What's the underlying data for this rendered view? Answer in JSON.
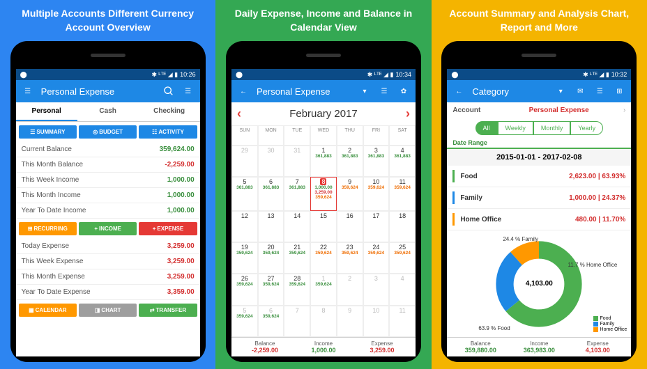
{
  "panels": {
    "p1": {
      "title": "Multiple Accounts Different Currency\nAccount Overview"
    },
    "p2": {
      "title": "Daily Expense, Income and Balance\nin Calendar View"
    },
    "p3": {
      "title": "Account Summary and Analysis\nChart, Report and More"
    }
  },
  "status": {
    "time1": "10:26",
    "time2": "10:34",
    "time3": "10:32"
  },
  "app1": {
    "title": "Personal Expense",
    "tabs": [
      "Personal",
      "Cash",
      "Checking"
    ],
    "btns1": [
      "SUMMARY",
      "BUDGET",
      "ACTIVITY"
    ],
    "rows1": [
      {
        "l": "Current Balance",
        "v": "359,624.00",
        "c": "green"
      },
      {
        "l": "This Month Balance",
        "v": "-2,259.00",
        "c": "red"
      },
      {
        "l": "This Week Income",
        "v": "1,000.00",
        "c": "green"
      },
      {
        "l": "This Month Income",
        "v": "1,000.00",
        "c": "green"
      },
      {
        "l": "Year To Date Income",
        "v": "1,000.00",
        "c": "green"
      }
    ],
    "btns2": [
      "RECURRING",
      "INCOME",
      "EXPENSE"
    ],
    "rows2": [
      {
        "l": "Today Expense",
        "v": "3,259.00",
        "c": "red"
      },
      {
        "l": "This Week Expense",
        "v": "3,259.00",
        "c": "red"
      },
      {
        "l": "This Month Expense",
        "v": "3,259.00",
        "c": "red"
      },
      {
        "l": "Year To Date Expense",
        "v": "3,359.00",
        "c": "red"
      }
    ],
    "btns3": [
      "CALENDAR",
      "CHART",
      "TRANSFER"
    ]
  },
  "app2": {
    "title": "Personal Expense",
    "month": "February 2017",
    "days": [
      "SUN",
      "MON",
      "TUE",
      "WED",
      "THU",
      "FRI",
      "SAT"
    ],
    "footer": {
      "bal_l": "Balance",
      "bal_v": "-2,259.00",
      "inc_l": "Income",
      "inc_v": "1,000.00",
      "exp_l": "Expense",
      "exp_v": "3,259.00"
    }
  },
  "app3": {
    "title": "Category",
    "acct_l": "Account",
    "acct_v": "Personal Expense",
    "segs": [
      "All",
      "Weekly",
      "Monthly",
      "Yearly"
    ],
    "dr_l": "Date Range",
    "dr_v": "2015-01-01 - 2017-02-08",
    "cats": [
      {
        "n": "Food",
        "v": "2,623.00 | 63.93%",
        "c": "#4caf50"
      },
      {
        "n": "Family",
        "v": "1,000.00 | 24.37%",
        "c": "#1e88e5"
      },
      {
        "n": "Home Office",
        "v": "480.00 | 11.70%",
        "c": "#ff9800"
      }
    ],
    "total": "4,103.00",
    "slices": {
      "food": "63.9 %\nFood",
      "family": "24.4 %\nFamily",
      "home": "11.7 %\nHome Office"
    },
    "footer": {
      "bal_l": "Balance",
      "bal_v": "359,880.00",
      "inc_l": "Income",
      "inc_v": "363,983.00",
      "exp_l": "Expense",
      "exp_v": "4,103.00"
    }
  }
}
